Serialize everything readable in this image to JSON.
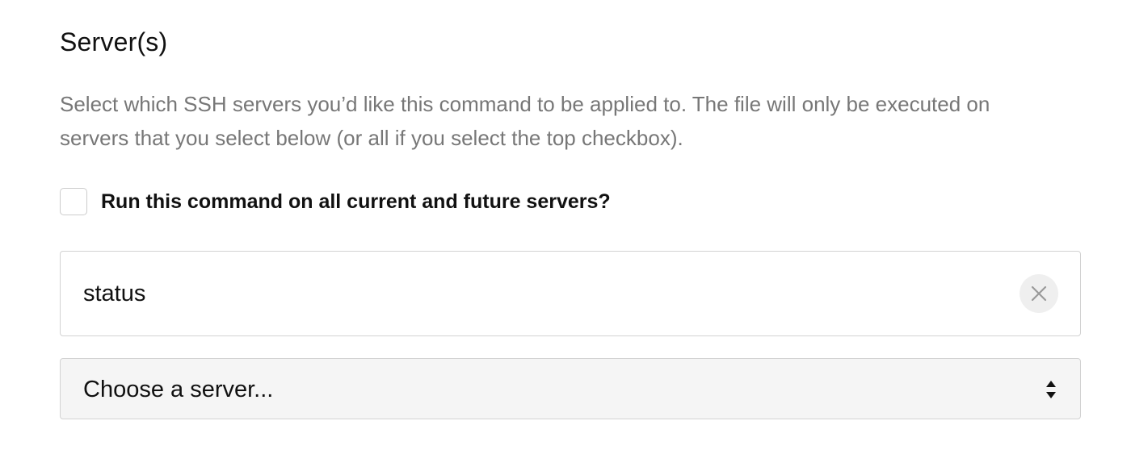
{
  "section": {
    "heading": "Server(s)",
    "description": "Select which SSH servers you’d like this command to be applied to. The file will only be executed on servers that you select below (or all if you select the top checkbox)."
  },
  "all_servers_checkbox": {
    "label": "Run this command on all current and future servers?",
    "checked": false
  },
  "selected_server": {
    "value": "status",
    "clear_icon": "close-icon"
  },
  "server_select": {
    "placeholder": "Choose a server...",
    "arrow_icon": "sort-arrows-icon"
  },
  "colors": {
    "text": "#111111",
    "muted_text": "#777777",
    "border": "#d2d2d2",
    "select_bg": "#f5f5f5",
    "clear_bg": "#efefef"
  }
}
